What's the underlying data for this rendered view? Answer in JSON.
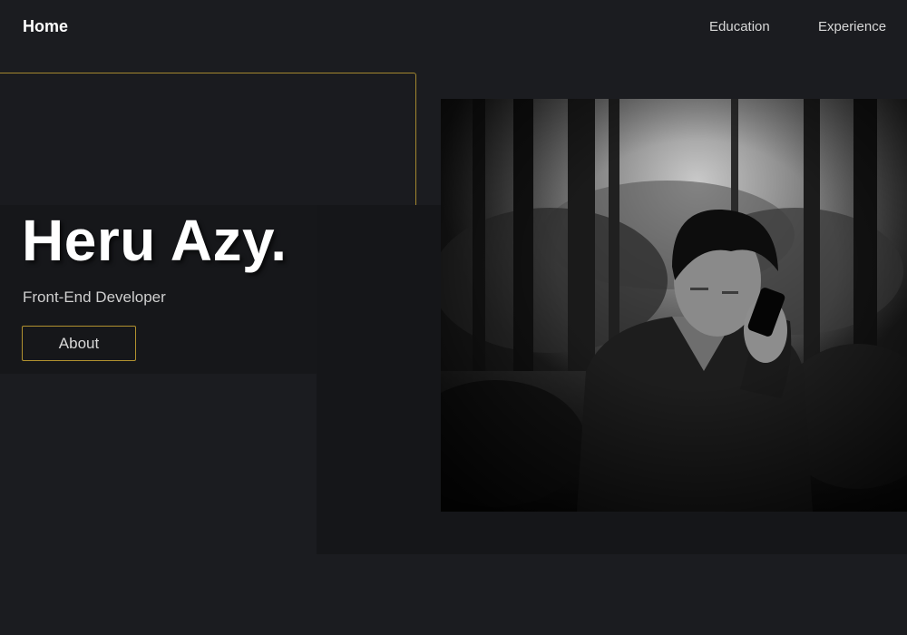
{
  "nav": {
    "home_label": "Home",
    "links": [
      {
        "label": "Education"
      },
      {
        "label": "Experience"
      }
    ]
  },
  "hero": {
    "name": "Heru Azy.",
    "role": "Front-End Developer",
    "about_button": "About"
  },
  "photo": {
    "icon": "portrait-photo",
    "description_visible": false
  },
  "colors": {
    "background": "#1b1c20",
    "accent": "#b1912f",
    "panel": "#151619",
    "text": "#ffffff"
  }
}
